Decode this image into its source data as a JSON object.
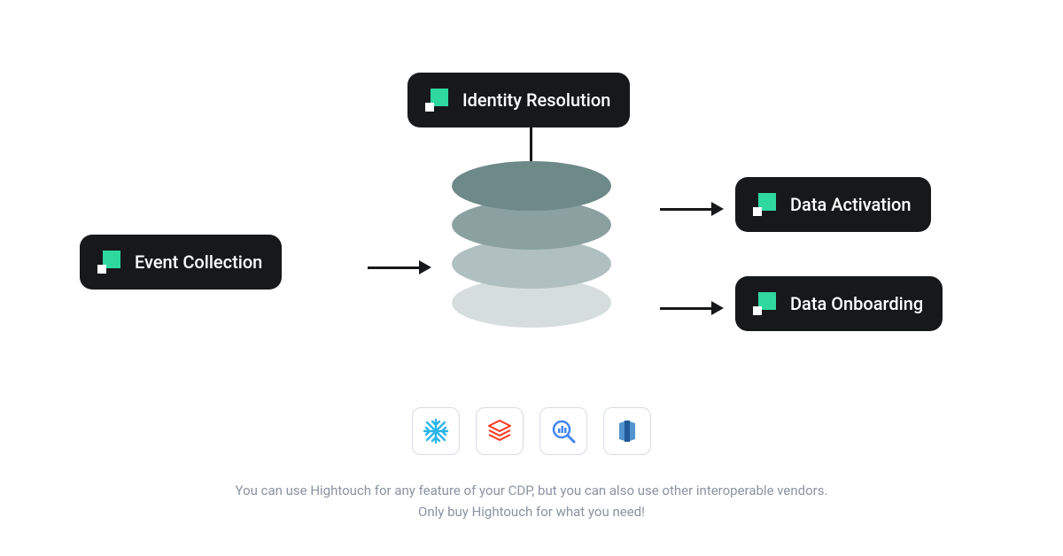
{
  "nodes": {
    "identity_resolution": "Identity Resolution",
    "event_collection": "Event Collection",
    "data_activation": "Data Activation",
    "data_onboarding": "Data Onboarding"
  },
  "vendors": [
    {
      "name": "snowflake-icon",
      "color": "#29b5e8"
    },
    {
      "name": "databricks-icon",
      "color": "#ff3621"
    },
    {
      "name": "bigquery-icon",
      "color": "#4285f4"
    },
    {
      "name": "redshift-icon",
      "color": "#205b97"
    }
  ],
  "caption_line1": "You can use Hightouch for any feature of your CDP, but you can also use other interoperable vendors.",
  "caption_line2": "Only buy Hightouch for what you need!"
}
